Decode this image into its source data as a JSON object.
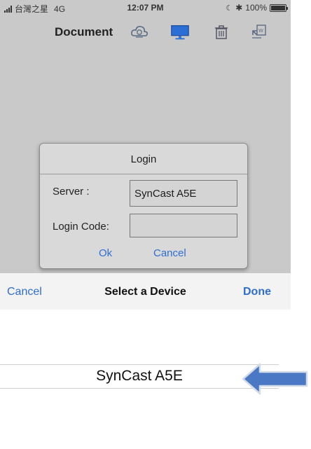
{
  "status": {
    "carrier": "台灣之星",
    "network": "4G",
    "time": "12:07 PM",
    "battery": "100%"
  },
  "navbar": {
    "title": "Document",
    "icons": [
      "cloud-icon",
      "monitor-icon",
      "trash-icon",
      "export-icon"
    ]
  },
  "login_dialog": {
    "title": "Login",
    "server_label": "Server :",
    "server_value": "SynCast A5E",
    "login_code_label": "Login Code:",
    "login_code_value": "",
    "ok_label": "Ok",
    "cancel_label": "Cancel"
  },
  "picker": {
    "cancel_label": "Cancel",
    "title": "Select a Device",
    "done_label": "Done",
    "selected_device": "SynCast A5E"
  },
  "colors": {
    "accent": "#2f6ecf",
    "arrow": "#4a78c4",
    "dim_background": "#c9c9c9"
  }
}
